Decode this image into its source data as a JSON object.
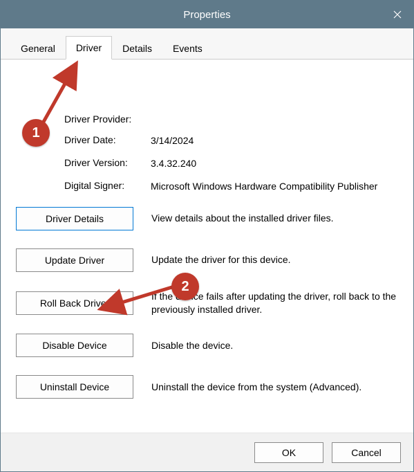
{
  "window": {
    "title": "Properties"
  },
  "tabs": {
    "general": "General",
    "driver": "Driver",
    "details": "Details",
    "events": "Events",
    "active": "driver"
  },
  "info": {
    "provider_label": "Driver Provider:",
    "provider_value": "",
    "date_label": "Driver Date:",
    "date_value": "3/14/2024",
    "version_label": "Driver Version:",
    "version_value": "3.4.32.240",
    "signer_label": "Digital Signer:",
    "signer_value": "Microsoft Windows Hardware Compatibility Publisher"
  },
  "actions": {
    "details_label": "Driver Details",
    "details_desc": "View details about the installed driver files.",
    "update_label": "Update Driver",
    "update_desc": "Update the driver for this device.",
    "rollback_label": "Roll Back Driver",
    "rollback_desc": "If the device fails after updating the driver, roll back to the previously installed driver.",
    "disable_label": "Disable Device",
    "disable_desc": "Disable the device.",
    "uninstall_label": "Uninstall Device",
    "uninstall_desc": "Uninstall the device from the system (Advanced)."
  },
  "footer": {
    "ok": "OK",
    "cancel": "Cancel"
  },
  "annotations": {
    "step1": "1",
    "step2": "2"
  }
}
